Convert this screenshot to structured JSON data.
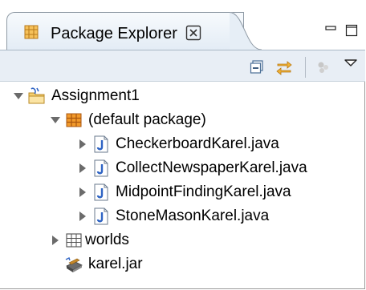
{
  "view": {
    "title": "Package Explorer",
    "close_glyph": "☒",
    "icons": {
      "view_icon": "package-explorer-icon",
      "close": "close-icon",
      "minimize": "minimize-icon",
      "maximize": "maximize-icon"
    }
  },
  "toolbar": {
    "buttons": [
      {
        "name": "collapse-all-icon"
      },
      {
        "name": "link-with-editor-icon"
      },
      {
        "name": "view-filter-icon"
      },
      {
        "name": "view-menu-chevron-icon"
      }
    ]
  },
  "tree": {
    "project": {
      "label": "Assignment1",
      "expanded": true
    },
    "package": {
      "label": "(default package)",
      "expanded": true
    },
    "files": [
      {
        "label": "CheckerboardKarel.java"
      },
      {
        "label": "CollectNewspaperKarel.java"
      },
      {
        "label": "MidpointFindingKarel.java"
      },
      {
        "label": "StoneMasonKarel.java"
      }
    ],
    "folder": {
      "label": "worlds",
      "expanded": false
    },
    "jar": {
      "label": "karel.jar"
    }
  },
  "colors": {
    "tab_border": "#8f9aa5",
    "toolbar_bg": "#e8eef5",
    "accent_orange": "#e8901a",
    "java_blue": "#2f64c4"
  }
}
